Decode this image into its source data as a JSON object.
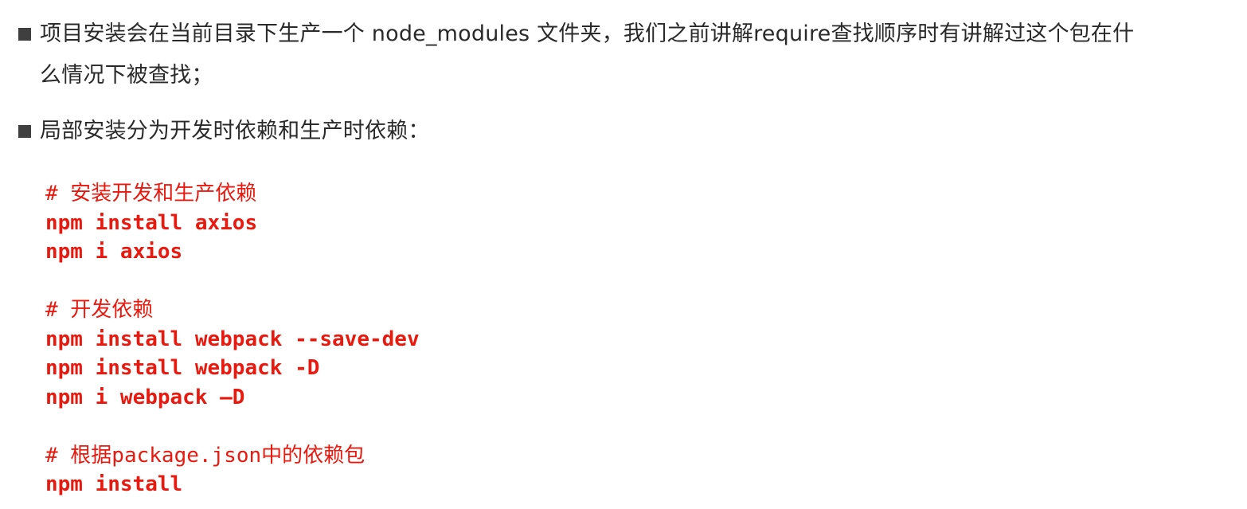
{
  "bullets": [
    {
      "lines": [
        "项目安装会在当前目录下生产一个 node_modules 文件夹，我们之前讲解require查找顺序时有讲解过这个包在什",
        "么情况下被查找；"
      ]
    },
    {
      "lines": [
        "局部安装分为开发时依赖和生产时依赖："
      ]
    }
  ],
  "code": {
    "groups": [
      {
        "comment": "# 安装开发和生产依赖",
        "commands": [
          "npm install axios",
          "npm i axios"
        ]
      },
      {
        "comment": "# 开发依赖",
        "commands": [
          "npm install webpack --save-dev",
          "npm install webpack -D",
          "npm i webpack –D"
        ]
      },
      {
        "comment": "# 根据package.json中的依赖包",
        "commands": [
          "npm install"
        ]
      }
    ]
  },
  "colors": {
    "code_text": "#e8190e",
    "body_text": "#2a2a2a",
    "bullet": "#3f3f3f"
  }
}
